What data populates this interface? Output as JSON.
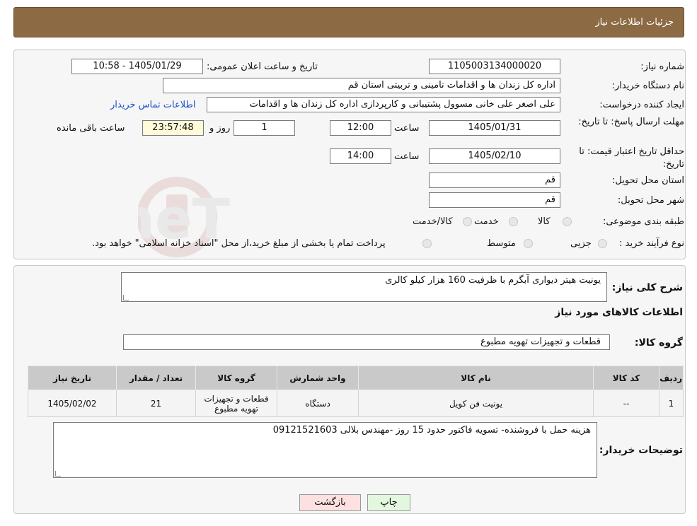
{
  "header": {
    "title": "جزئیات اطلاعات نیاز"
  },
  "watermark": {
    "text": "AriaTender.neT"
  },
  "details": {
    "need_number_label": "شماره نیاز:",
    "need_number": "1105003134000020",
    "announce_label": "تاریخ و ساعت اعلان عمومی:",
    "announce_value": "1405/01/29 - 10:58",
    "buyer_label": "نام دستگاه خریدار:",
    "buyer_value": "اداره کل زندان ها و اقدامات تامینی و تربیتی استان قم",
    "requester_label": "ایجاد کننده درخواست:",
    "requester_value": "علی اصغر علی خانی مسوول پشتیبانی و کارپردازی اداره کل زندان ها و اقدامات",
    "contact_link": "اطلاعات تماس خریدار",
    "deadline_label": "مهلت ارسال پاسخ: تا تاریخ:",
    "deadline_date": "1405/01/31",
    "time_label": "ساعت",
    "deadline_time": "12:00",
    "days_value": "1",
    "days_label": "روز و",
    "remaining_value": "23:57:48",
    "remaining_label": "ساعت باقی مانده",
    "validity_label": "حداقل تاریخ اعتبار قیمت: تا تاریخ:",
    "validity_date": "1405/02/10",
    "validity_time": "14:00",
    "province_label": "استان محل تحویل:",
    "province_value": "قم",
    "city_label": "شهر محل تحویل:",
    "city_value": "قم",
    "category_label": "طبقه بندی موضوعی:",
    "category_options": [
      "کالا",
      "خدمت",
      "کالا/خدمت"
    ],
    "process_label": "نوع فرآیند خرید :",
    "process_options": [
      "جزیی",
      "متوسط"
    ],
    "process_note": "پرداخت تمام یا بخشی از مبلغ خرید،از محل \"اسناد خزانه اسلامی\" خواهد بود."
  },
  "summary": {
    "description_label": "شرح کلی نیاز:",
    "description_value": "یونیت هیتر دیواری آبگرم با ظرفیت 160 هزار کیلو کالری",
    "items_heading": "اطلاعات کالاهای مورد نیاز",
    "group_label": "گروه کالا:",
    "group_value": "قطعات و تجهیزات تهویه مطبوع"
  },
  "table": {
    "headers": [
      "ردیف",
      "کد کالا",
      "نام کالا",
      "واحد شمارش",
      "گروه کالا",
      "تعداد / مقدار",
      "تاریخ نیاز"
    ],
    "rows": [
      [
        "1",
        "--",
        "یونیت فن کویل",
        "دستگاه",
        "قطعات و تجهیزات تهویه مطبوع",
        "21",
        "1405/02/02"
      ]
    ]
  },
  "notes": {
    "label": "توضیحات خریدار:",
    "value": "هزینه حمل با فروشنده- تسویه فاکتور حدود 15 روز -مهندس بلالی 09121521603"
  },
  "buttons": {
    "back": "بازگشت",
    "print": "چاپ"
  },
  "colors": {
    "header": "#8c6b44",
    "back_button": "#fde0e0",
    "print_button": "#e3f7df",
    "link": "#1b50c9",
    "timer_bg": "#fffbd9"
  }
}
